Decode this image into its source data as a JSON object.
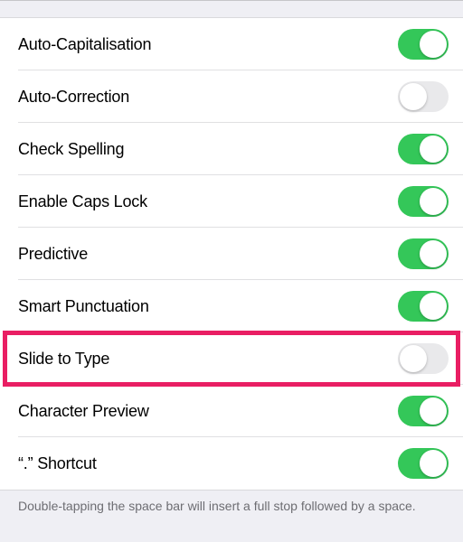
{
  "settings": [
    {
      "id": "auto-capitalisation",
      "label": "Auto-Capitalisation",
      "on": true
    },
    {
      "id": "auto-correction",
      "label": "Auto-Correction",
      "on": false
    },
    {
      "id": "check-spelling",
      "label": "Check Spelling",
      "on": true
    },
    {
      "id": "enable-caps-lock",
      "label": "Enable Caps Lock",
      "on": true
    },
    {
      "id": "predictive",
      "label": "Predictive",
      "on": true
    },
    {
      "id": "smart-punctuation",
      "label": "Smart Punctuation",
      "on": true
    },
    {
      "id": "slide-to-type",
      "label": "Slide to Type",
      "on": false,
      "highlighted": true
    },
    {
      "id": "character-preview",
      "label": "Character Preview",
      "on": true
    },
    {
      "id": "period-shortcut",
      "label": "“.” Shortcut",
      "on": true
    }
  ],
  "footer": "Double-tapping the space bar will insert a full stop followed by a space.",
  "colors": {
    "toggle_on": "#34c759",
    "toggle_off": "#e9e9eb",
    "highlight": "#e91e63"
  }
}
